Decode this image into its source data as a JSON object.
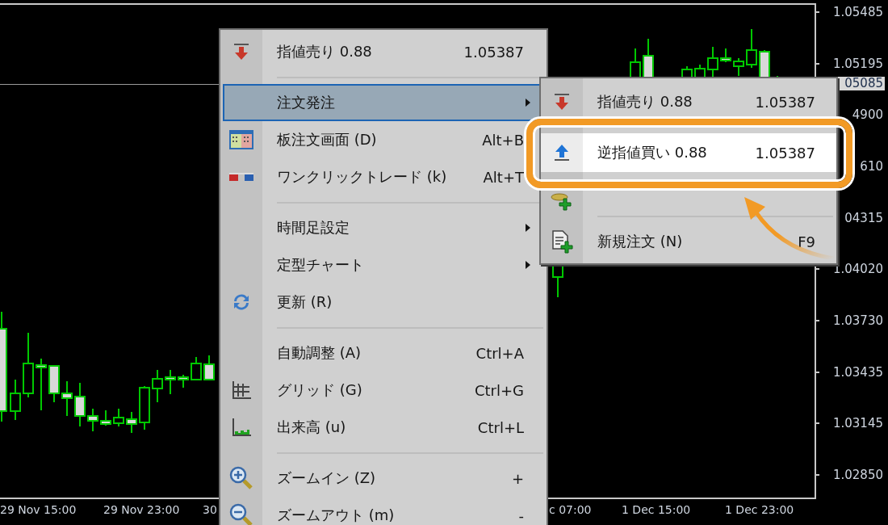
{
  "chart": {
    "price_axis": {
      "labels": [
        "1.05485",
        "1.05195",
        "4900",
        "610",
        "04315",
        "1.04020",
        "1.03730",
        "1.03435",
        "1.03145",
        "1.02850"
      ],
      "current_price": "05085"
    },
    "time_axis": {
      "labels": [
        "29 Nov 15:00",
        "29 Nov 23:00",
        "30",
        "c 07:00",
        "1 Dec 15:00",
        "1 Dec 23:00"
      ]
    }
  },
  "context_menu": {
    "items": [
      {
        "kind": "item",
        "label": "指値売り 0.88",
        "shortcut": "1.05387",
        "submenu": false,
        "selected": false
      },
      {
        "kind": "separator"
      },
      {
        "kind": "item",
        "label": "注文発注",
        "submenu": true,
        "selected": true
      },
      {
        "kind": "item",
        "label": "板注文画面 (D)",
        "shortcut": "Alt+B",
        "selected": false
      },
      {
        "kind": "item",
        "label": "ワンクリックトレード (k)",
        "shortcut": "Alt+T",
        "selected": false
      },
      {
        "kind": "separator"
      },
      {
        "kind": "item",
        "label": "時間足設定",
        "submenu": true,
        "selected": false
      },
      {
        "kind": "item",
        "label": "定型チャート",
        "submenu": true,
        "selected": false
      },
      {
        "kind": "item",
        "label": "更新 (R)",
        "submenu": false,
        "selected": false
      },
      {
        "kind": "separator"
      },
      {
        "kind": "item",
        "label": "自動調整 (A)",
        "shortcut": "Ctrl+A",
        "submenu": false,
        "selected": false
      },
      {
        "kind": "item",
        "label": "グリッド (G)",
        "shortcut": "Ctrl+G",
        "submenu": false,
        "selected": false
      },
      {
        "kind": "item",
        "label": "出来高 (u)",
        "shortcut": "Ctrl+L",
        "submenu": false,
        "selected": false
      },
      {
        "kind": "separator"
      },
      {
        "kind": "item",
        "label": "ズームイン (Z)",
        "shortcut": "+",
        "submenu": false,
        "selected": false
      },
      {
        "kind": "item",
        "label": "ズームアウト (m)",
        "shortcut": "-",
        "submenu": false,
        "selected": false
      }
    ]
  },
  "submenu": {
    "items": [
      {
        "kind": "item",
        "label": "指値売り 0.88",
        "shortcut": "1.05387",
        "selected": false
      },
      {
        "kind": "item",
        "label": "逆指値買い 0.88",
        "shortcut": "1.05387",
        "selected": true
      },
      {
        "kind": "hidden"
      },
      {
        "kind": "separator"
      },
      {
        "kind": "item",
        "label": "新規注文 (N)",
        "shortcut": "F9",
        "selected": false
      }
    ]
  }
}
